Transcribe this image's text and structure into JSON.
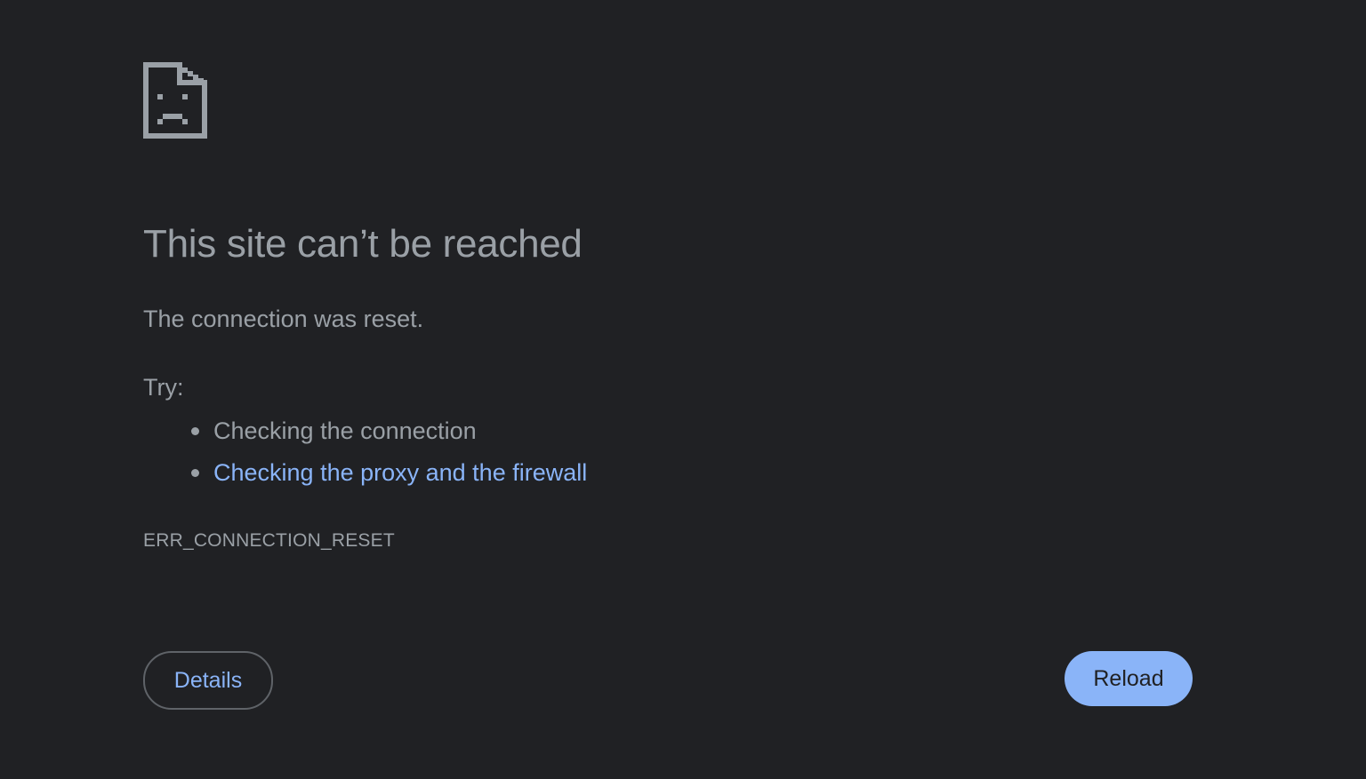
{
  "page": {
    "icon": "sad-page-icon",
    "title": "This site can’t be reached",
    "message": "The connection was reset.",
    "try_label": "Try:",
    "suggestions": [
      {
        "text": "Checking the connection",
        "is_link": false
      },
      {
        "text": "Checking the proxy and the firewall",
        "is_link": true
      }
    ],
    "error_code": "ERR_CONNECTION_RESET"
  },
  "buttons": {
    "details_label": "Details",
    "reload_label": "Reload"
  },
  "colors": {
    "background": "#202124",
    "text": "#9aa0a6",
    "link": "#8ab4f8",
    "primary_button": "#8ab4f8"
  }
}
